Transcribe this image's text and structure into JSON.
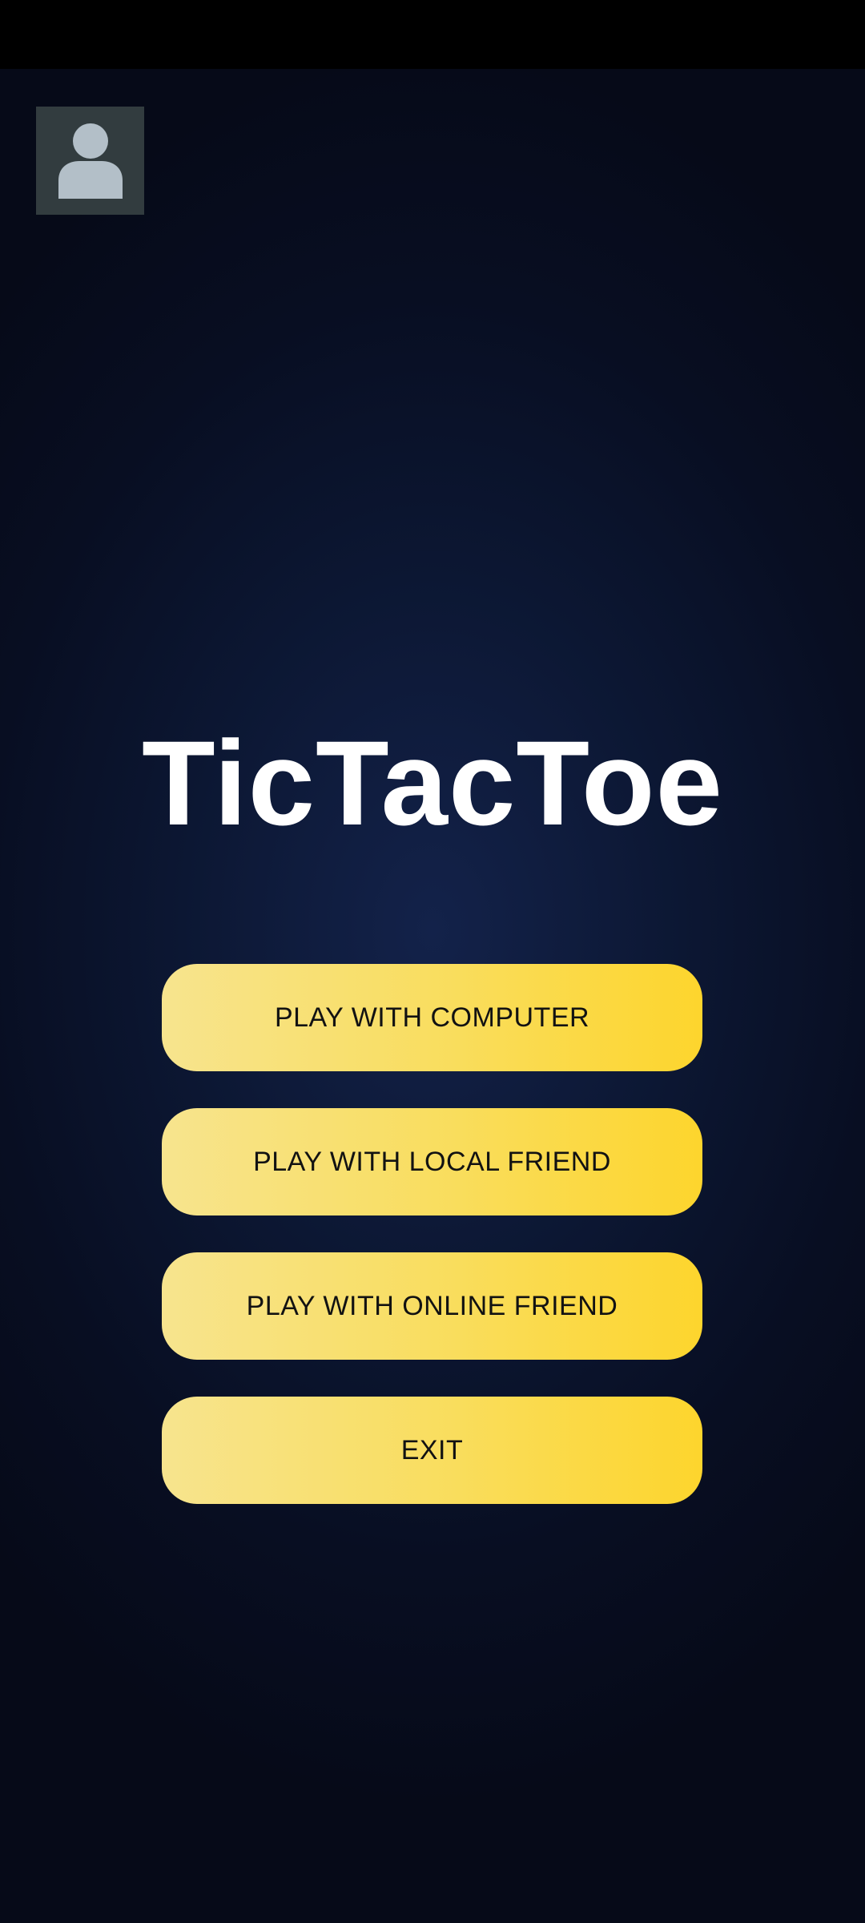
{
  "status_bar": {},
  "profile": {
    "icon": "user-avatar-icon"
  },
  "title": "TicTacToe",
  "menu": {
    "play_computer_label": "PLAY WITH COMPUTER",
    "play_local_label": "PLAY WITH LOCAL FRIEND",
    "play_online_label": "PLAY WITH ONLINE FRIEND",
    "exit_label": "EXIT"
  },
  "colors": {
    "background": "#0c1733",
    "button_gradient_start": "#f7e48e",
    "button_gradient_end": "#fdd52d",
    "title": "#ffffff",
    "avatar_bg": "#323c3f",
    "avatar_icon": "#b3bfc8"
  }
}
